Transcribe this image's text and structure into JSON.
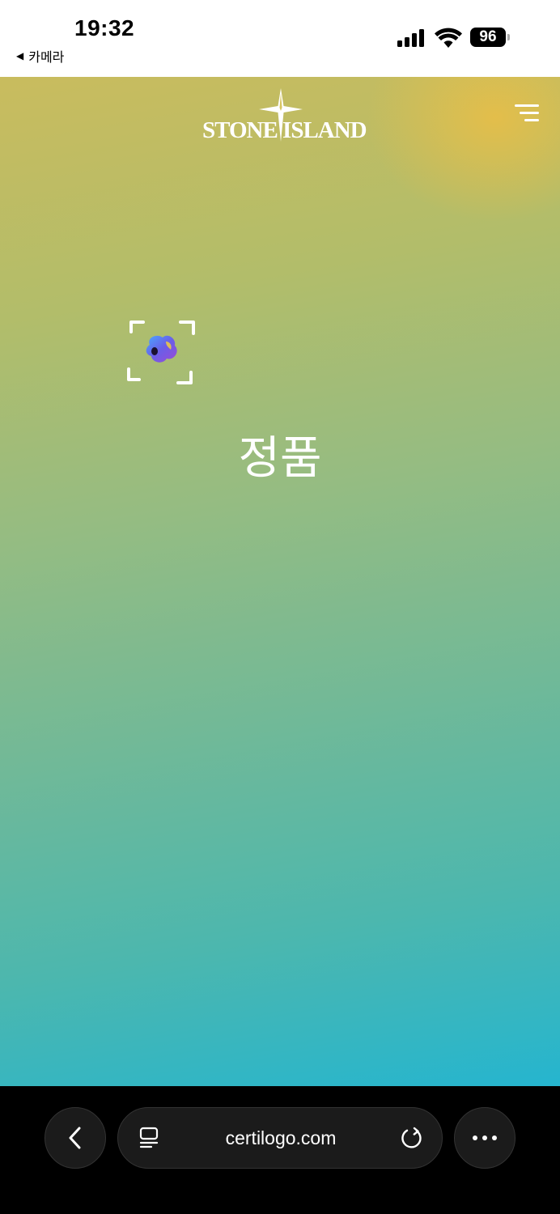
{
  "status_bar": {
    "time": "19:32",
    "back_app": "카메라",
    "back_icon": "back-triangle-icon",
    "battery": "96",
    "icons": [
      "cellular-signal-icon",
      "wifi-icon",
      "battery-icon"
    ]
  },
  "header": {
    "brand": "STONE ISLAND",
    "logo_icon": "compass-star-icon",
    "menu_icon": "hamburger-menu-icon"
  },
  "result": {
    "scan_icon": "scan-frame-icon",
    "verdict": "정품"
  },
  "browser": {
    "url": "certilogo.com",
    "back_icon": "chevron-left-icon",
    "tabs_icon": "tabs-icon",
    "reload_icon": "reload-icon",
    "more_icon": "more-dots-icon"
  },
  "colors": {
    "gradient_top": "#c9bc5e",
    "gradient_corner": "#e8be4a",
    "gradient_bottom": "#25b5cf",
    "browser_bg": "#000000",
    "button_bg": "#1b1b1b"
  }
}
